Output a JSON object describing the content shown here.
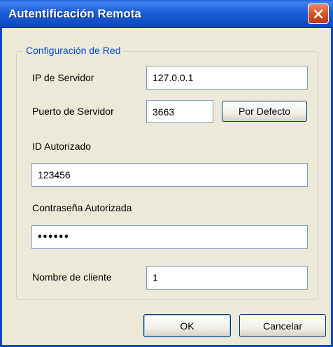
{
  "window": {
    "title": "Autentificación Remota"
  },
  "group": {
    "legend": "Configuración de Red"
  },
  "fields": {
    "server_ip": {
      "label": "IP de Servidor",
      "value": "127.0.0.1"
    },
    "server_port": {
      "label": "Puerto de Servidor",
      "value": "3663"
    },
    "auth_id": {
      "label": "ID Autorizado",
      "value": "123456"
    },
    "auth_password": {
      "label": "Contraseña Autorizada",
      "value": "••••••"
    },
    "client_name": {
      "label": "Nombre de cliente",
      "value": "1"
    }
  },
  "buttons": {
    "default_port": "Por Defecto",
    "ok": "OK",
    "cancel": "Cancelar"
  },
  "icons": {
    "close": "close-icon"
  },
  "colors": {
    "titlebar": "#0a48c2",
    "legend": "#0046d5",
    "background": "#ece9d8",
    "close": "#d6532c"
  }
}
